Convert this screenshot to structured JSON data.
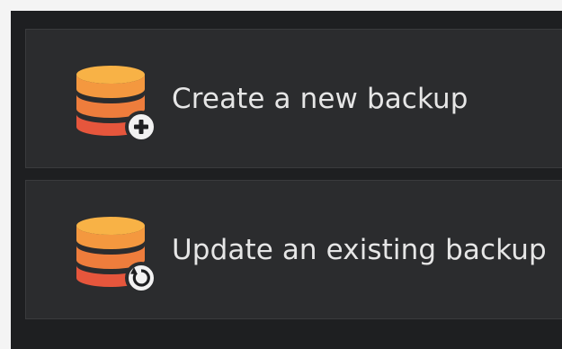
{
  "options": [
    {
      "label": "Create a new backup",
      "icon": "database-add-icon"
    },
    {
      "label": "Update an existing backup",
      "icon": "database-refresh-icon"
    }
  ],
  "colors": {
    "panel_bg": "#1e1f21",
    "option_bg": "#2b2c2e",
    "text": "#e6e6e6",
    "db_top": "#f6a540",
    "db_bottom": "#e8503c"
  }
}
